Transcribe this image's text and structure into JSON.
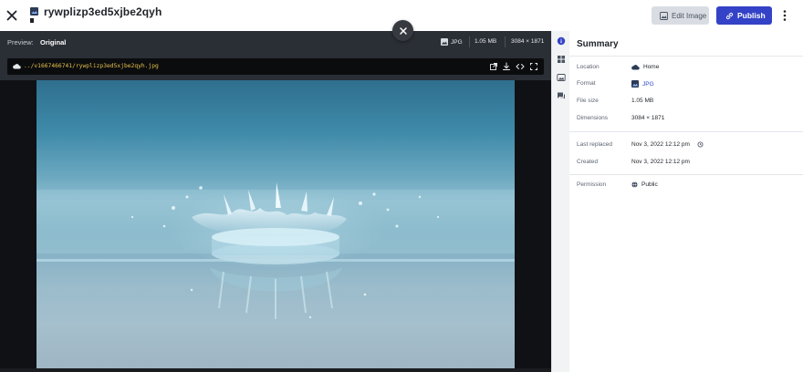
{
  "header": {
    "title": "rywplizp3ed5xjbe2qyh",
    "edit_label": "Edit Image",
    "publish_label": "Publish"
  },
  "preview": {
    "label": "Preview:",
    "mode": "Original",
    "format": "JPG",
    "size": "1.05 MB",
    "dimensions": "3084 × 1871",
    "url": "../v1667466741/rywplizp3ed5xjbe2qyh.jpg"
  },
  "summary": {
    "title": "Summary",
    "location_label": "Location",
    "location_value": "Home",
    "format_label": "Format",
    "format_value": "JPG",
    "filesize_label": "File size",
    "filesize_value": "1.05 MB",
    "dimensions_label": "Dimensions",
    "dimensions_value": "3084 × 1871",
    "last_replaced_label": "Last replaced",
    "last_replaced_value": "Nov 3, 2022 12:12 pm",
    "created_label": "Created",
    "created_value": "Nov 3, 2022 12:12 pm",
    "permission_label": "Permission",
    "permission_value": "Public"
  },
  "colors": {
    "primary": "#3342c6",
    "url_text": "#e5c04b",
    "preview_bg": "#2a2e35"
  }
}
